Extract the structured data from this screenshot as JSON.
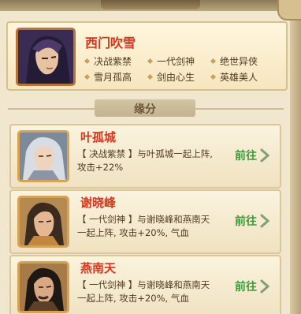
{
  "hero": {
    "name": "西门吹雪",
    "traits": [
      "决战紫禁",
      "一代剑神",
      "绝世异侠",
      "雪月孤高",
      "剑由心生",
      "英雄美人"
    ]
  },
  "section": {
    "title": "缘分"
  },
  "fates": [
    {
      "name": "叶孤城",
      "desc_line1": "【 决战紫禁 】与叶孤城一起上阵,",
      "desc_line2": "攻击+22%",
      "button": "前往"
    },
    {
      "name": "谢晓峰",
      "desc_line1": "【 一代剑神 】与谢晓峰和燕南天",
      "desc_line2": "一起上阵, 攻击+20%, 气血",
      "button": "前往"
    },
    {
      "name": "燕南天",
      "desc_line1": "【 一代剑神 】与谢晓峰和燕南天",
      "desc_line2": "一起上阵, 攻击+20%, 气血",
      "button": "前往"
    }
  ],
  "colors": {
    "name_red": "#d8351e",
    "button_green": "#3d9a3a",
    "panel_bg": "#f1e7cf"
  },
  "icons": [
    "hero-portrait-icon",
    "fate-portrait-icon",
    "chevron-right-icon",
    "diamond-bullet-icon"
  ]
}
